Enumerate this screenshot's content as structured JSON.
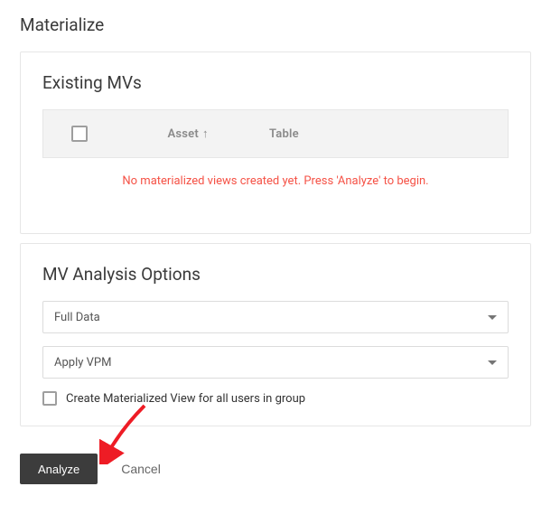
{
  "dialog": {
    "title": "Materialize"
  },
  "existing": {
    "title": "Existing MVs",
    "columns": {
      "asset": "Asset",
      "table": "Table"
    },
    "empty_message": "No materialized views created yet. Press 'Analyze' to begin."
  },
  "options": {
    "title": "MV Analysis Options",
    "select_data": "Full Data",
    "select_vpm": "Apply VPM",
    "checkbox_label": "Create Materialized View for all users in group"
  },
  "actions": {
    "analyze": "Analyze",
    "cancel": "Cancel"
  },
  "colors": {
    "error": "#f55246",
    "primary_button_bg": "#3c3c3c",
    "annotation_arrow": "#ee1c25"
  }
}
